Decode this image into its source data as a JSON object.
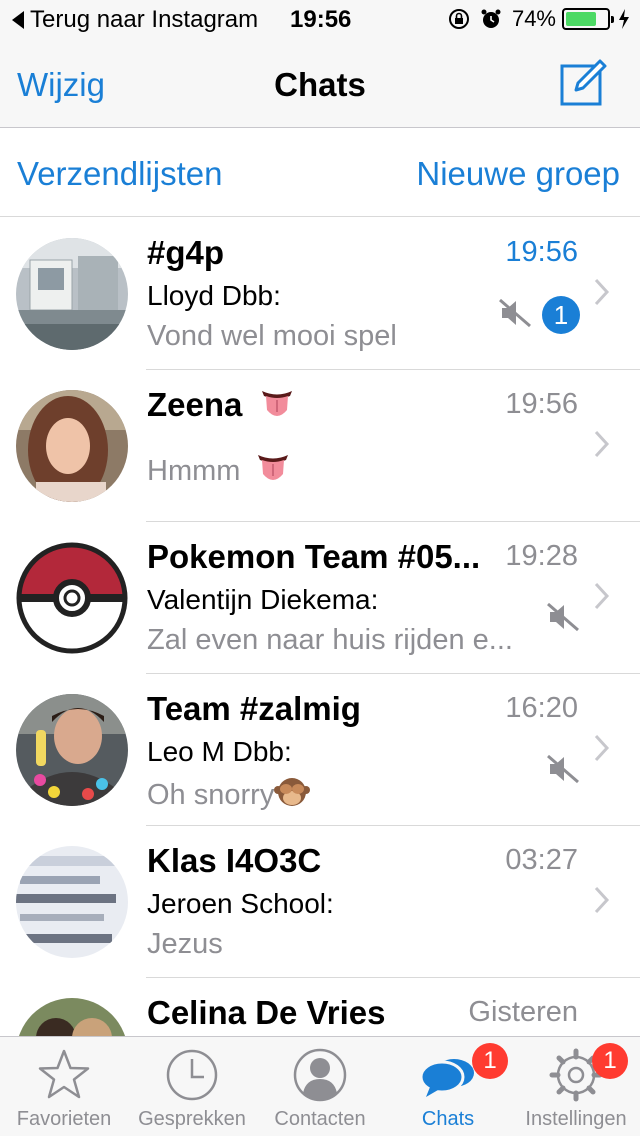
{
  "status_bar": {
    "back_label": "Terug naar Instagram",
    "time": "19:56",
    "battery": "74%",
    "battery_level": 0.74,
    "icons": [
      "back-arrow-icon",
      "orientation-lock-icon",
      "alarm-icon",
      "battery-icon",
      "charging-bolt-icon"
    ]
  },
  "nav": {
    "left_label": "Wijzig",
    "title": "Chats",
    "compose_icon": "compose-icon"
  },
  "list_actions": {
    "broadcast_label": "Verzendlijsten",
    "new_group_label": "Nieuwe groep"
  },
  "chats": [
    {
      "name": "#g4p",
      "time": "19:56",
      "sender": "Lloyd Dbb:",
      "message": "Vond wel mooi spel",
      "muted": true,
      "unread": "1"
    },
    {
      "name": "Zeena",
      "time": "19:56",
      "sender": "",
      "message": "Hmmm",
      "muted": false,
      "unread": ""
    },
    {
      "name": "Pokemon Team #05...",
      "time": "19:28",
      "sender": "Valentijn Diekema:",
      "message": "Zal even naar huis rijden e...",
      "muted": true,
      "unread": ""
    },
    {
      "name": "Team #zalmig",
      "time": "16:20",
      "sender": "Leo M Dbb:",
      "message": "Oh snorry",
      "muted": true,
      "unread": ""
    },
    {
      "name": "Klas I4O3C",
      "time": "03:27",
      "sender": "Jeroen School:",
      "message": "Jezus",
      "muted": false,
      "unread": ""
    },
    {
      "name": "Celina De Vries",
      "time": "Gisteren",
      "sender": "",
      "message": "",
      "muted": false,
      "unread": ""
    }
  ],
  "tabs": [
    {
      "label": "Favorieten",
      "icon": "star-icon",
      "badge": ""
    },
    {
      "label": "Gesprekken",
      "icon": "clock-icon",
      "badge": ""
    },
    {
      "label": "Contacten",
      "icon": "contact-icon",
      "badge": ""
    },
    {
      "label": "Chats",
      "icon": "chat-bubbles-icon",
      "badge": "1"
    },
    {
      "label": "Instellingen",
      "icon": "gear-icon",
      "badge": "1"
    }
  ],
  "colors": {
    "accent": "#1a7fd6",
    "badge_red": "#ff3b30",
    "battery_green": "#4cd964",
    "secondary_text": "#8e8e93"
  }
}
